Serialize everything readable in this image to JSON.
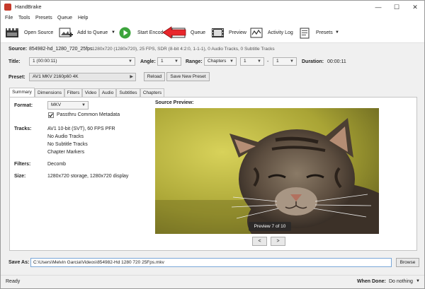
{
  "window": {
    "title": "HandBrake",
    "minimize": "—",
    "maximize": "☐",
    "close": "✕"
  },
  "menu": [
    "File",
    "Tools",
    "Presets",
    "Queue",
    "Help"
  ],
  "toolbar": {
    "open_source": "Open Source",
    "add_to_queue": "Add to Queue",
    "start_encode": "Start Encode",
    "queue": "Queue",
    "preview": "Preview",
    "activity_log": "Activity Log",
    "presets": "Presets"
  },
  "source": {
    "label": "Source:",
    "name": "854982-hd_1280_720_25fps",
    "info": "1280x720 (1280x720), 25 FPS, SDR (8-bit 4:2:0, 1-1-1), 0 Audio Tracks, 0 Subtitle Tracks"
  },
  "title_row": {
    "title_label": "Title:",
    "title_value": "1  (00:00:11)",
    "angle_label": "Angle:",
    "angle_value": "1",
    "range_label": "Range:",
    "range_value": "Chapters",
    "range_start": "1",
    "range_sep": "-",
    "range_end": "1",
    "duration_label": "Duration:",
    "duration_value": "00:00:11"
  },
  "preset": {
    "label": "Preset:",
    "value": "AV1 MKV 2160p60 4K",
    "reload": "Reload",
    "save_new": "Save New Preset"
  },
  "tabs": [
    "Summary",
    "Dimensions",
    "Filters",
    "Video",
    "Audio",
    "Subtitles",
    "Chapters"
  ],
  "summary": {
    "format_label": "Format:",
    "format_value": "MKV",
    "passthru": "Passthru Common Metadata",
    "passthru_checked": true,
    "tracks_label": "Tracks:",
    "tracks": [
      "AV1 10-bit (SVT), 60 FPS PFR",
      "No Audio Tracks",
      "No Subtitle Tracks",
      "Chapter Markers"
    ],
    "filters_label": "Filters:",
    "filters_value": "Decomb",
    "size_label": "Size:",
    "size_value": "1280x720 storage, 1280x720 display",
    "preview_label": "Source Preview:",
    "preview_counter": "Preview 7 of 10",
    "prev_btn": "<",
    "next_btn": ">"
  },
  "save_as": {
    "label": "Save As:",
    "path": "C:\\Users\\Melvin Garcia\\Videos\\854982-Hd 1280 720 25Fps.mkv",
    "browse": "Browse"
  },
  "status": {
    "text": "Ready",
    "when_done_label": "When Done:",
    "when_done_value": "Do nothing"
  },
  "colors": {
    "accent": "#3a7bd5",
    "start_green": "#3ca43c",
    "annotation_arrow": "#e8262b"
  }
}
